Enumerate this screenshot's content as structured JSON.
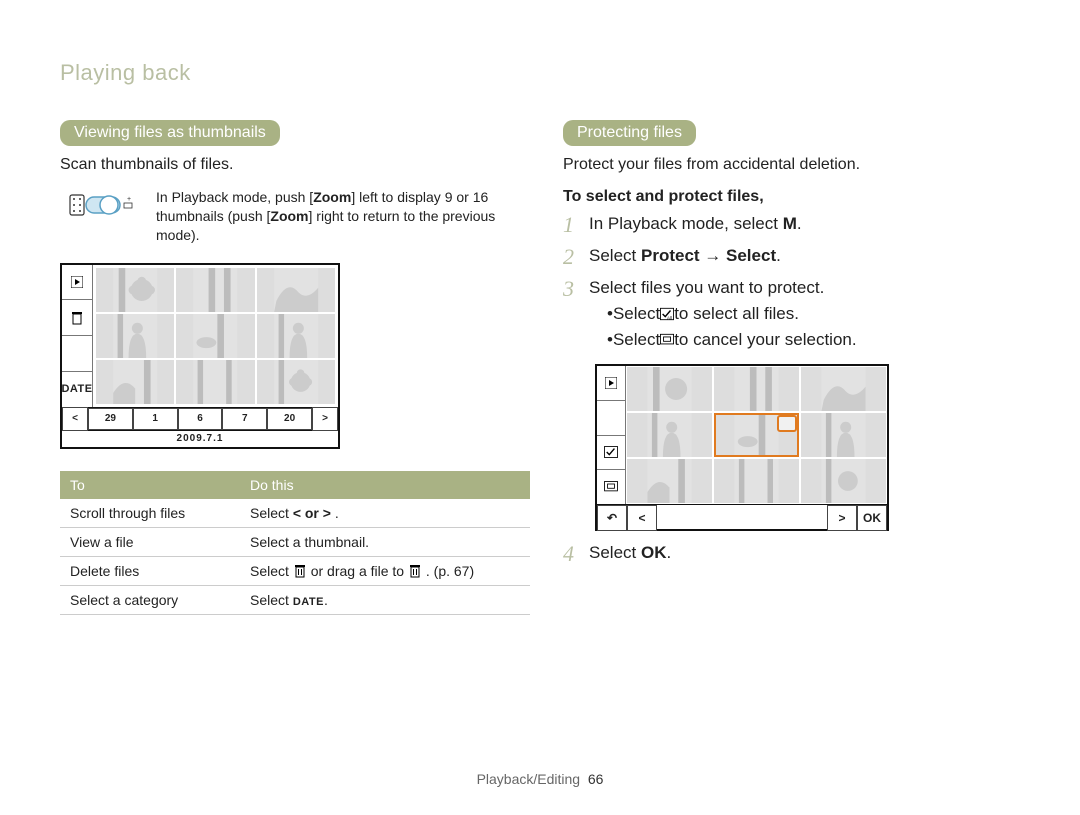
{
  "breadcrumb": "Playing back",
  "left": {
    "heading": "Viewing ﬁles as thumbnails",
    "lead": "Scan thumbnails of files.",
    "note": {
      "pre": "In Playback mode, push [",
      "zoom": "Zoom",
      "mid1": "] left to display 9 or 16 thumbnails (push [",
      "mid2": "] right to return to the previous mode)."
    },
    "filmstrip": [
      "29",
      "1",
      "6",
      "7",
      "20"
    ],
    "datebar": "2009.7.1",
    "table": {
      "h1": "To",
      "h2": "Do this",
      "rows": [
        {
          "a": "Scroll through files",
          "b_pre": "Select ",
          "b_body": "< or >",
          "b_post": " ."
        },
        {
          "a": "View a file",
          "b_pre": "",
          "b_body": "Select a thumbnail.",
          "b_post": ""
        },
        {
          "a": "Delete files",
          "b_pre": "Select ",
          "b_body": "",
          "b_post": " or drag a file to       . (p. 67)"
        },
        {
          "a": "Select a category",
          "b_pre": "Select ",
          "b_body": "",
          "b_post": "."
        }
      ]
    }
  },
  "right": {
    "heading": "Protecting ﬁles",
    "lead": "Protect your files from accidental deletion.",
    "subhead": "To select and protect ﬁles,",
    "steps": {
      "s1_pre": "In Playback mode, select ",
      "s1_icon": "M",
      "s1_post": ".",
      "s2_pre": "Select ",
      "s2_b1": "Protect",
      "s2_arrow": " → ",
      "s2_b2": "Select",
      "s2_post": ".",
      "s3": "Select files you want to protect.",
      "s3a_pre": "Select ",
      "s3a_post": " to select all files.",
      "s3b_pre": "Select ",
      "s3b_post": " to cancel your selection.",
      "s4_pre": "Select ",
      "s4_post": "."
    },
    "ok_label": "OK"
  },
  "footer": {
    "section": "Playback/Editing",
    "page": "66"
  }
}
